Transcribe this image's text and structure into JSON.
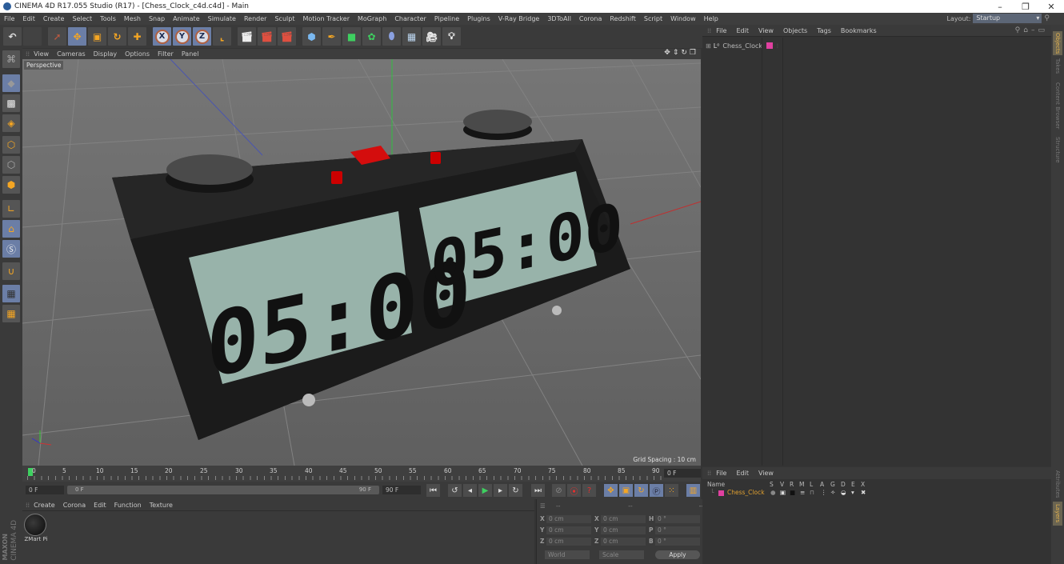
{
  "window": {
    "title": "CINEMA 4D R17.055 Studio (R17) - [Chess_Clock_c4d.c4d] - Main",
    "minimize": "–",
    "restore": "❐",
    "close": "✕"
  },
  "menubar": {
    "items": [
      "File",
      "Edit",
      "Create",
      "Select",
      "Tools",
      "Mesh",
      "Snap",
      "Animate",
      "Simulate",
      "Render",
      "Sculpt",
      "Motion Tracker",
      "MoGraph",
      "Character",
      "Pipeline",
      "Plugins",
      "V-Ray Bridge",
      "3DToAll",
      "Corona",
      "Redshift",
      "Script",
      "Window",
      "Help"
    ],
    "layout_label": "Layout:",
    "layout_value": "Startup"
  },
  "toolbar": {
    "undo": "↶",
    "axis_x": "X",
    "axis_y": "Y",
    "axis_z": "Z"
  },
  "viewport": {
    "menu": [
      "View",
      "Cameras",
      "Display",
      "Options",
      "Filter",
      "Panel"
    ],
    "camera_label": "Perspective",
    "grid_spacing": "Grid Spacing : 10 cm",
    "scene": {
      "left_display": "05:00",
      "right_display": "05:00",
      "body_color": "#1e1e1e",
      "lcd_color": "#98b3aa",
      "button_color": "#d40d0d"
    }
  },
  "timeline": {
    "ticks": [
      "0",
      "5",
      "10",
      "15",
      "20",
      "25",
      "30",
      "35",
      "40",
      "45",
      "50",
      "55",
      "60",
      "65",
      "70",
      "75",
      "80",
      "85",
      "90"
    ],
    "current_frame_right": "0 F"
  },
  "transport": {
    "start_field": "0 F",
    "slider_start": "0 F",
    "slider_end": "90 F",
    "end_field": "90 F"
  },
  "material_manager": {
    "menu": [
      "Create",
      "Corona",
      "Edit",
      "Function",
      "Texture"
    ],
    "materials": [
      {
        "name": "ZMart Pi"
      }
    ]
  },
  "coordinates": {
    "headers": [
      "--",
      "--",
      "--"
    ],
    "rows": [
      {
        "l1": "X",
        "v1": "0 cm",
        "l2": "X",
        "v2": "0 cm",
        "l3": "H",
        "v3": "0 °"
      },
      {
        "l1": "Y",
        "v1": "0 cm",
        "l2": "Y",
        "v2": "0 cm",
        "l3": "P",
        "v3": "0 °"
      },
      {
        "l1": "Z",
        "v1": "0 cm",
        "l2": "Z",
        "v2": "0 cm",
        "l3": "B",
        "v3": "0 °"
      }
    ],
    "mode_world": "World",
    "mode_scale": "Scale",
    "apply": "Apply"
  },
  "object_manager": {
    "menu": [
      "File",
      "Edit",
      "View",
      "Objects",
      "Tags",
      "Bookmarks"
    ],
    "objects": [
      {
        "name": "Chess_Clock",
        "tag_color": "#e040a0"
      }
    ]
  },
  "layer_manager": {
    "menu": [
      "File",
      "Edit",
      "View"
    ],
    "columns": [
      "Name",
      "S",
      "V",
      "R",
      "M",
      "L",
      "A",
      "G",
      "D",
      "E",
      "X"
    ],
    "layers": [
      {
        "name": "Chess_Clock",
        "color": "#e040a0"
      }
    ]
  },
  "right_tabs": {
    "top": [
      "Objects",
      "Takes",
      "Content Browser",
      "Structure"
    ],
    "bottom": [
      "Attributes",
      "Layers"
    ]
  },
  "branding": {
    "line1": "MAXON",
    "line2": "CINEMA 4D"
  }
}
